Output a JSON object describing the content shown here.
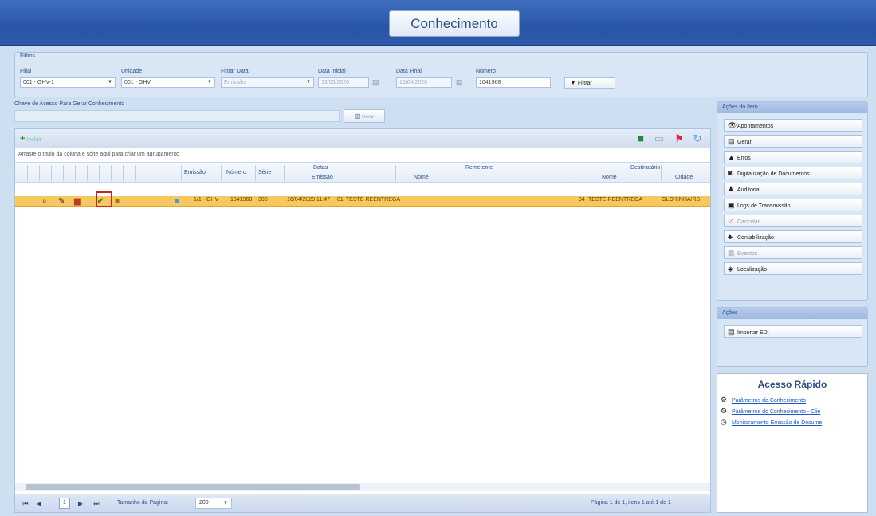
{
  "app": {
    "title": "Conhecimento"
  },
  "filters": {
    "heading": "Filtros",
    "filial_label": "Filial",
    "filial_value": "001 - GHV-1",
    "unidade_label": "Unidade",
    "unidade_value": "001 - GHV",
    "filtrar_data_label": "Filtrar Data",
    "filtrar_data_value": "Emissão",
    "data_inicial_label": "Data Inicial",
    "data_inicial_value": "13/03/2020",
    "data_final_label": "Data Final",
    "data_final_value": "16/04/2020",
    "numero_label": "Número",
    "numero_value": "1041968",
    "filter_button": "Filtrar"
  },
  "chave": {
    "label": "Chave de Acesso Para Gerar Conhecimento",
    "button": "Gerar"
  },
  "grid": {
    "add_label": "Incluir",
    "group_hint": "Arraste o título da coluna e solte aqui para criar um agrupamento",
    "headers": {
      "emissao": "Emissão",
      "numero": "Número",
      "serie": "Série",
      "datas": "Datas",
      "datas_emissao": "Emissão",
      "remetente": "Remetente",
      "remetente_nome": "Nome",
      "destinatario": "Destinatário",
      "dest_nome": "Nome",
      "dest_cidade": "Cidade"
    },
    "row": {
      "emissao_unit": "1/1 - GHV",
      "numero": "1041968",
      "serie": "300",
      "data": "16/04/2020 11:47",
      "remetente_code": "01",
      "remetente": "TESTE REENTREGA",
      "dest_code": "04",
      "destinatario": "TESTE REENTREGA",
      "cidade": "GLORINHA/RS"
    }
  },
  "pager": {
    "page": "1",
    "page_size_label": "Tamanho da Página:",
    "page_size": "200",
    "info": "Página 1 de 1, itens 1 até 1 de 1"
  },
  "acoes_item": {
    "heading": "Ações do Item",
    "buttons": [
      "Apontamentos",
      "Gerar",
      "Erros",
      "Digitalização de Documentos",
      "Auditoria",
      "Logs de Transmissão",
      "Cancelar",
      "Contabilização",
      "Eventos",
      "Localização"
    ]
  },
  "acoes": {
    "heading": "Ações",
    "importar": "Importar EDI"
  },
  "quick": {
    "title": "Acesso Rápido",
    "links": [
      "Parâmetros do Conhecimento",
      "Parâmetros do Conhecimento - Clie",
      "Monitoramento Emissão de Docume"
    ]
  },
  "colors": {
    "accent": "#2a55a6",
    "row_selected": "#f8c860",
    "highlight": "#d41f1f"
  }
}
